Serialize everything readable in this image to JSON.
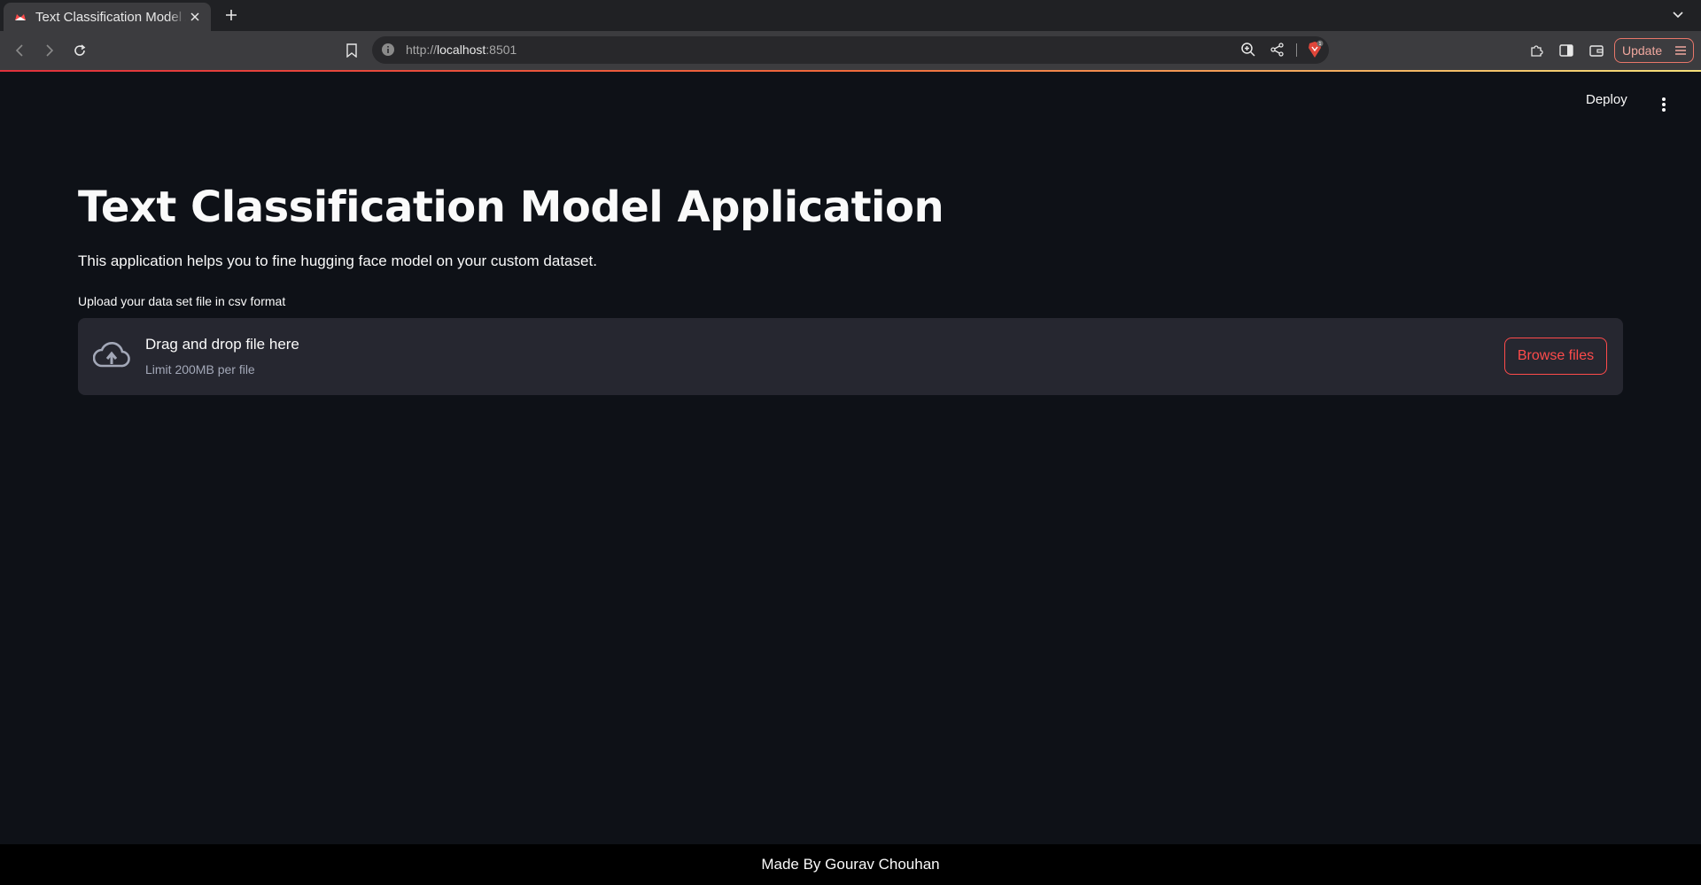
{
  "browser": {
    "tab_title": "Text Classification Model Application",
    "url_scheme": "http://",
    "url_host": "localhost",
    "url_port": ":8501",
    "update_label": "Update",
    "brave_badge": "1",
    "colors": {
      "progress_start": "#e0313c",
      "progress_end": "#f5e07a",
      "update_accent": "#e8776a"
    }
  },
  "app": {
    "deploy_label": "Deploy",
    "title": "Text Classification Model Application",
    "description": "This application helps you to fine hugging face model on your custom dataset.",
    "upload": {
      "label": "Upload your data set file in csv format",
      "dropzone_title": "Drag and drop file here",
      "dropzone_limit": "Limit 200MB per file",
      "browse_label": "Browse files"
    },
    "footer": "Made By Gourav Chouhan",
    "colors": {
      "background": "#0e1117",
      "accent": "#ff4b4b",
      "dropzone": "#262730"
    }
  }
}
